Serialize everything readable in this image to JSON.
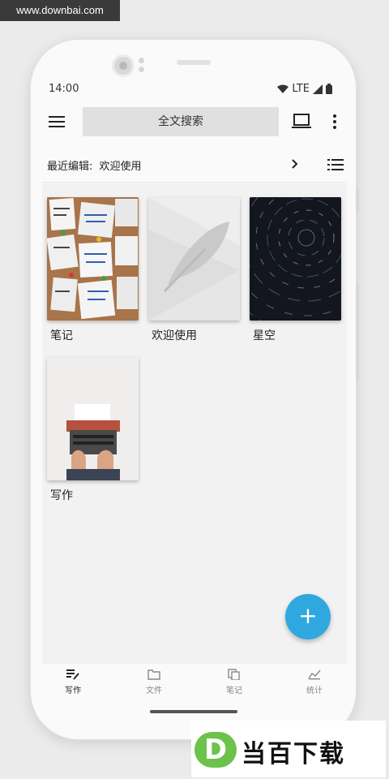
{
  "watermark": {
    "site": "www.downbai.com",
    "logo_letter": "D",
    "logo_text": "当百下载"
  },
  "status": {
    "time": "14:00",
    "network": "LTE"
  },
  "appbar": {
    "search_label": "全文搜索"
  },
  "recent": {
    "label": "最近编辑:",
    "value": "欢迎使用"
  },
  "notebooks": [
    {
      "title": "笔记",
      "cover": "sticky-notes-board"
    },
    {
      "title": "欢迎使用",
      "cover": "feather-placeholder"
    },
    {
      "title": "星空",
      "cover": "star-trails"
    },
    {
      "title": "写作",
      "cover": "typewriter"
    }
  ],
  "fab": {
    "label": "+"
  },
  "bottom_nav": [
    {
      "label": "写作",
      "icon": "write-icon",
      "active": true
    },
    {
      "label": "文件",
      "icon": "folder-icon",
      "active": false
    },
    {
      "label": "笔记",
      "icon": "notes-icon",
      "active": false
    },
    {
      "label": "统计",
      "icon": "stats-icon",
      "active": false
    }
  ],
  "colors": {
    "accent": "#2fa8e0",
    "search_bg": "#e0e0e0",
    "logo_green": "#6cc24a"
  }
}
